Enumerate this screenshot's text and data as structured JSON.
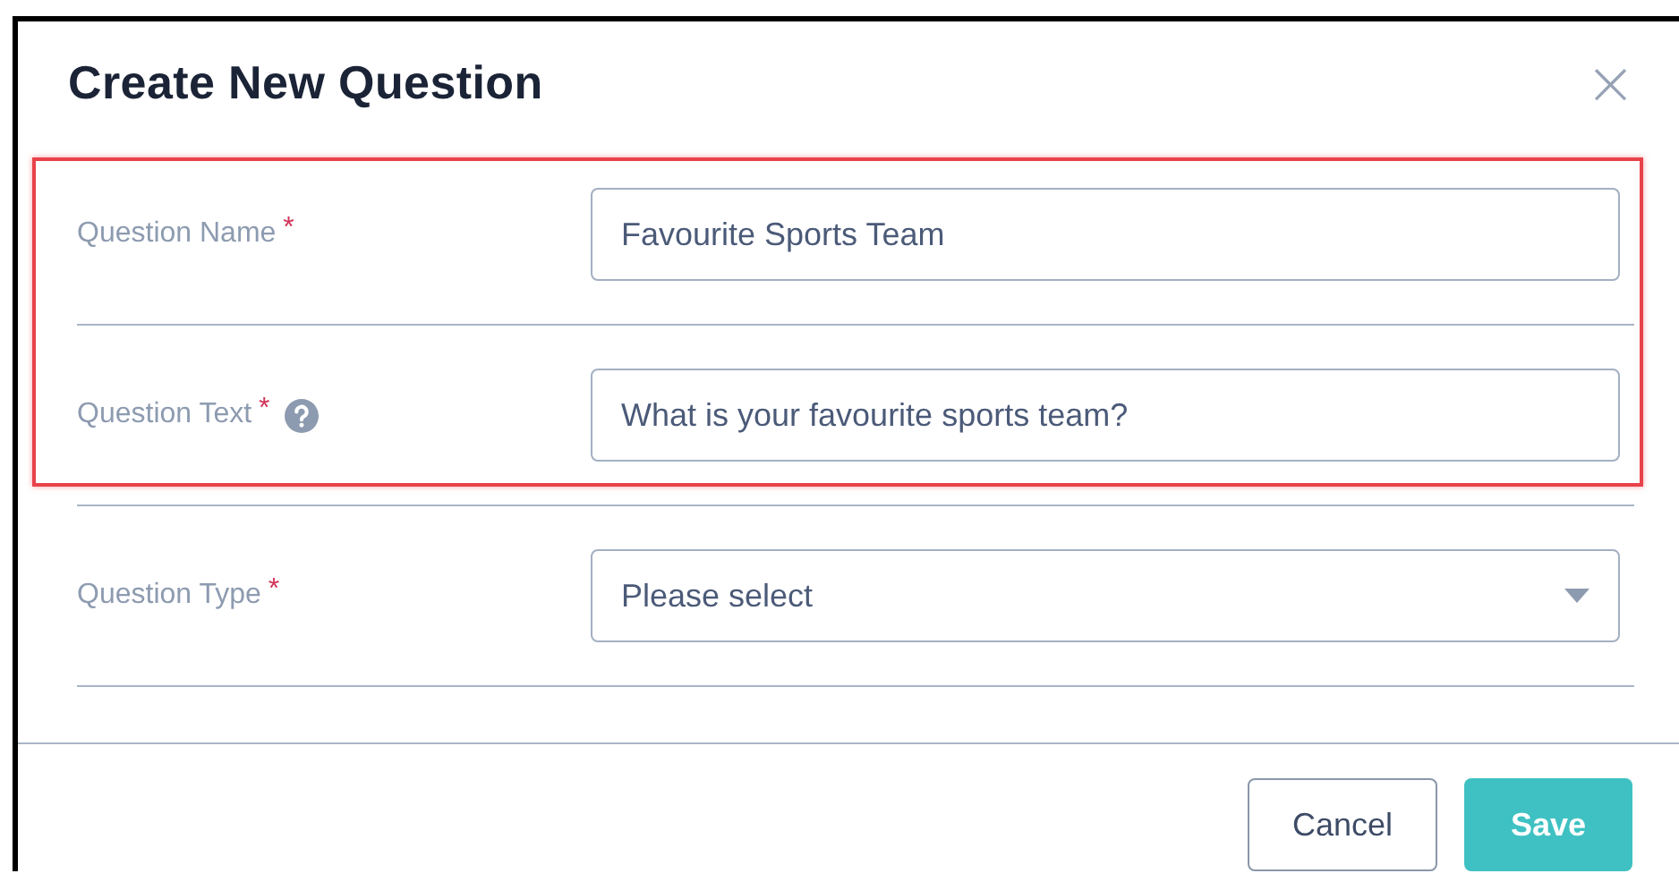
{
  "dialog": {
    "title": "Create New Question",
    "close": "×"
  },
  "rows": [
    {
      "label": "Question Name",
      "required_mark": "*",
      "help": false,
      "kind": "text",
      "value": "Favourite Sports Team",
      "highlighted": true
    },
    {
      "label": "Question Text",
      "required_mark": "*",
      "help": true,
      "kind": "text",
      "value": "What is your favourite sports team?",
      "highlighted": true
    },
    {
      "label": "Question Type",
      "required_mark": "*",
      "help": false,
      "kind": "select",
      "value": "Please select",
      "highlighted": false
    }
  ],
  "buttons": [
    {
      "label": "Cancel",
      "kind": "secondary"
    },
    {
      "label": "Save",
      "kind": "primary"
    }
  ]
}
